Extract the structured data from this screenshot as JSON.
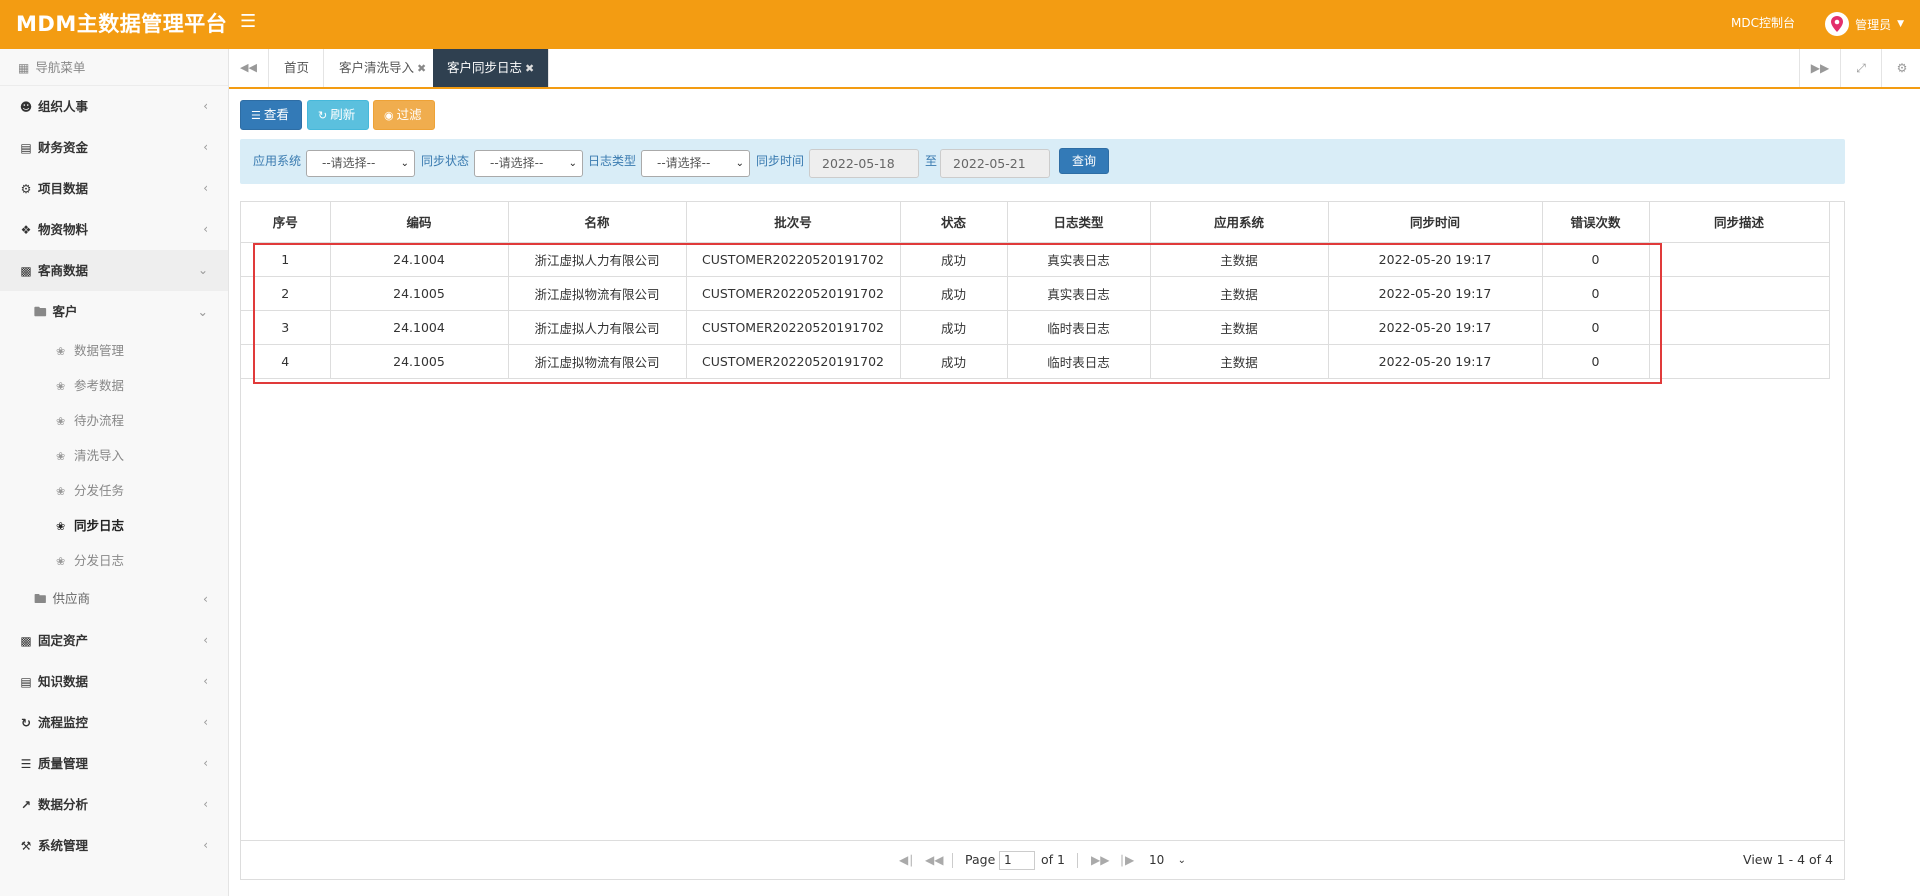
{
  "app": {
    "title": "MDM主数据管理平台",
    "menu_icon": "hamburger-icon"
  },
  "header": {
    "console_link": "MDC控制台",
    "user_name": "管理员",
    "user_icon": "location-pin-icon"
  },
  "sidebar": {
    "title": "导航菜单",
    "groups": [
      {
        "label": "组织人事",
        "icon": "users-icon"
      },
      {
        "label": "财务资金",
        "icon": "credit-card-icon"
      },
      {
        "label": "项目数据",
        "icon": "sitemap-icon"
      },
      {
        "label": "物资物料",
        "icon": "cubes-icon"
      },
      {
        "label": "客商数据",
        "icon": "suitcase-icon"
      }
    ],
    "customer": {
      "label": "客户",
      "leaves": [
        "数据管理",
        "参考数据",
        "待办流程",
        "清洗导入",
        "分发任务",
        "同步日志",
        "分发日志"
      ]
    },
    "supplier": {
      "label": "供应商"
    },
    "bottom_groups": [
      {
        "label": "固定资产",
        "icon": "archive-icon"
      },
      {
        "label": "知识数据",
        "icon": "file-text-icon"
      },
      {
        "label": "流程监控",
        "icon": "spinner-icon"
      },
      {
        "label": "质量管理",
        "icon": "list-alt-icon"
      },
      {
        "label": "数据分析",
        "icon": "line-chart-icon"
      },
      {
        "label": "系统管理",
        "icon": "wrench-icon"
      }
    ]
  },
  "tabs": [
    {
      "label": "首页"
    },
    {
      "label": "客户清洗导入"
    },
    {
      "label": "客户同步日志"
    }
  ],
  "toolbar": {
    "view": "查看",
    "refresh": "刷新",
    "filter": "过滤"
  },
  "filters": {
    "app_system_label": "应用系统",
    "app_system_value": "--请选择--",
    "sync_status_label": "同步状态",
    "sync_status_value": "--请选择--",
    "log_type_label": "日志类型",
    "log_type_value": "--请选择--",
    "sync_time_label": "同步时间",
    "date_from": "2022-05-18",
    "date_sep": "至",
    "date_to": "2022-05-21",
    "query": "查询"
  },
  "table": {
    "headers": [
      "序号",
      "编码",
      "名称",
      "批次号",
      "状态",
      "日志类型",
      "应用系统",
      "同步时间",
      "错误次数",
      "同步描述"
    ],
    "rows": [
      [
        "1",
        "24.1004",
        "浙江虚拟人力有限公司",
        "CUSTOMER20220520191702",
        "成功",
        "真实表日志",
        "主数据",
        "2022-05-20 19:17",
        "0",
        ""
      ],
      [
        "2",
        "24.1005",
        "浙江虚拟物流有限公司",
        "CUSTOMER20220520191702",
        "成功",
        "真实表日志",
        "主数据",
        "2022-05-20 19:17",
        "0",
        ""
      ],
      [
        "3",
        "24.1004",
        "浙江虚拟人力有限公司",
        "CUSTOMER20220520191702",
        "成功",
        "临时表日志",
        "主数据",
        "2022-05-20 19:17",
        "0",
        ""
      ],
      [
        "4",
        "24.1005",
        "浙江虚拟物流有限公司",
        "CUSTOMER20220520191702",
        "成功",
        "临时表日志",
        "主数据",
        "2022-05-20 19:17",
        "0",
        ""
      ]
    ]
  },
  "pager": {
    "page_label": "Page",
    "page_value": "1",
    "of_label": "of 1",
    "page_size": "10",
    "info": "View 1 - 4 of 4"
  },
  "colors": {
    "header": "#f39c12",
    "active_tab": "#2f4050",
    "highlight": "#e03a3a"
  }
}
